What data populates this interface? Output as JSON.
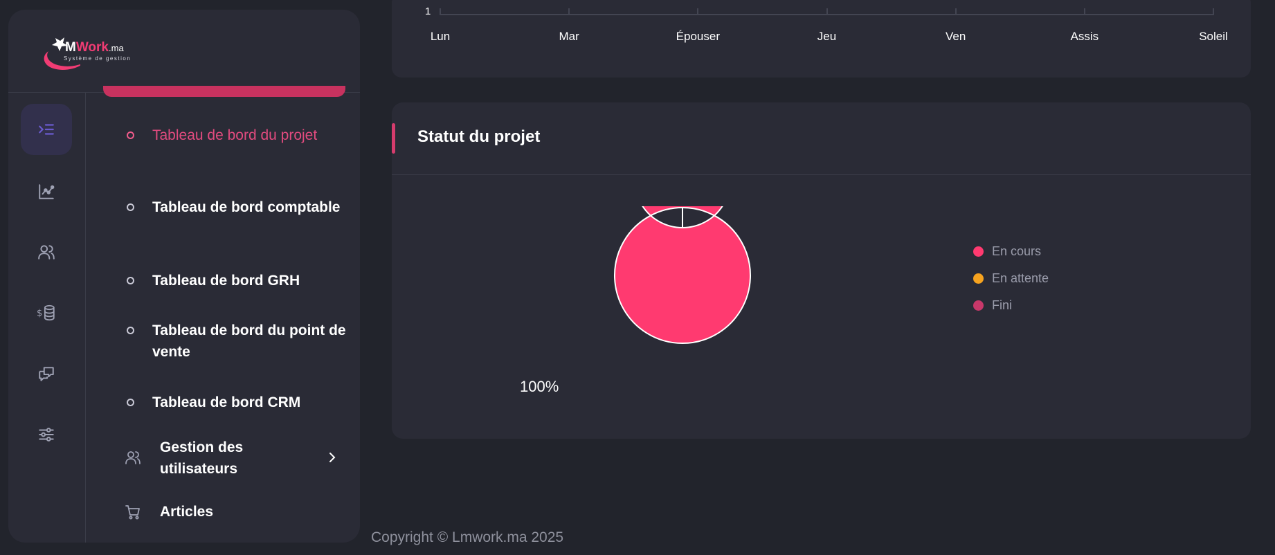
{
  "brand": {
    "name_part1": "M",
    "name_part2": "Work",
    "name_suffix": ".ma",
    "tagline": "Système de gestion",
    "accent_color": "#f13c74"
  },
  "rail": {
    "items": [
      {
        "icon": "indent-list-icon",
        "active": true
      },
      {
        "icon": "chart-line-icon",
        "active": false
      },
      {
        "icon": "users-icon",
        "active": false
      },
      {
        "icon": "dollar-coins-icon",
        "active": false
      },
      {
        "icon": "chat-bubbles-icon",
        "active": false
      },
      {
        "icon": "sliders-icon",
        "active": false
      }
    ]
  },
  "submenu": {
    "items": [
      {
        "label": "Tableau de bord du projet",
        "active": true
      },
      {
        "label": "Tableau de bord comptable",
        "active": false
      },
      {
        "label": "Tableau de bord GRH",
        "active": false
      },
      {
        "label": "Tableau de bord du point de vente",
        "active": false
      },
      {
        "label": "Tableau de bord CRM",
        "active": false
      }
    ],
    "groups": [
      {
        "label": "Gestion des utilisateurs",
        "icon": "users-icon",
        "has_chevron": true
      },
      {
        "label": "Articles",
        "icon": "cart-icon",
        "has_chevron": false
      }
    ]
  },
  "top_chart": {
    "y_tick": "1",
    "x_ticks": [
      "Lun",
      "Mar",
      "Épouser",
      "Jeu",
      "Ven",
      "Assis",
      "Soleil"
    ]
  },
  "status_card": {
    "title": "Statut du projet",
    "chart_data": {
      "type": "pie",
      "categories": [
        "En cours",
        "En attente",
        "Fini"
      ],
      "values": [
        100,
        0,
        0
      ],
      "colors": [
        "#ff3a70",
        "#f6a31f",
        "#c8386a"
      ],
      "data_label": "100%",
      "legend": "right"
    }
  },
  "footer": {
    "copyright": "Copyright © Lmwork.ma 2025"
  }
}
